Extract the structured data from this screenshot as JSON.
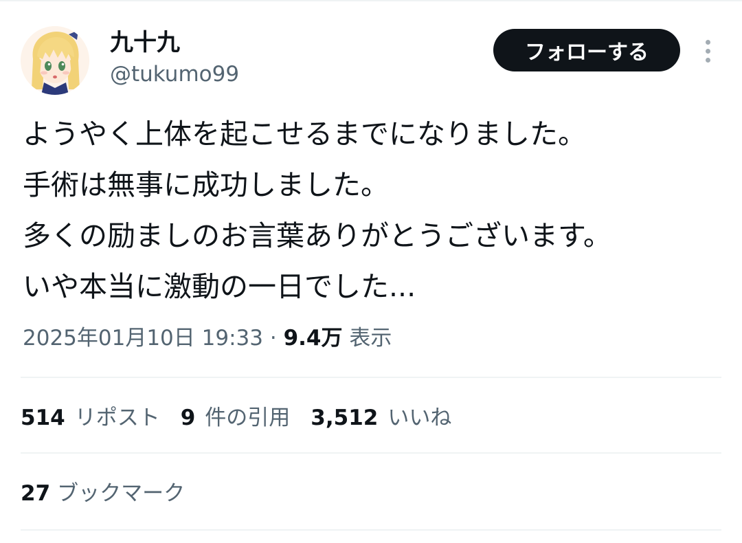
{
  "user": {
    "display_name": "九十九",
    "handle": "@tukumo99",
    "avatar_icon": "anime-girl-avatar-icon"
  },
  "actions": {
    "follow_label": "フォローする",
    "more_icon": "vertical-ellipsis-icon"
  },
  "tweet": {
    "lines": [
      "ようやく上体を起こせるまでになりました。",
      "手術は無事に成功しました。",
      "多くの励ましのお言葉ありがとうございます。",
      "いや本当に激動の一日でした..."
    ]
  },
  "meta": {
    "timestamp": "2025年01月10日 19:33",
    "separator": "·",
    "views": "9.4万",
    "views_label": "表示"
  },
  "stats": {
    "reposts": {
      "count": "514",
      "label": "リポスト"
    },
    "quotes": {
      "count": "9",
      "label": "件の引用"
    },
    "likes": {
      "count": "3,512",
      "label": "いいね"
    },
    "bookmarks": {
      "count": "27",
      "label": "ブックマーク"
    }
  },
  "colors": {
    "text_primary": "#0f1419",
    "text_secondary": "#536471",
    "divider": "#eff3f4",
    "follow_bg": "#0f1419",
    "follow_text": "#ffffff"
  }
}
